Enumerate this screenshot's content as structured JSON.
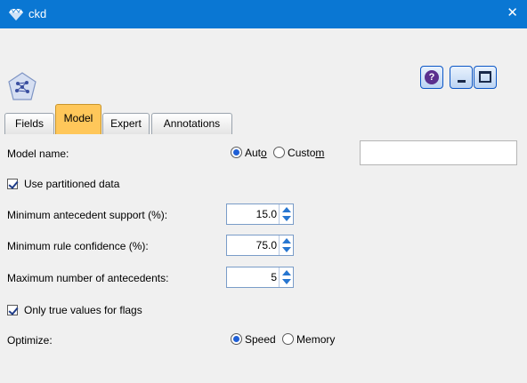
{
  "window": {
    "title": "ckd"
  },
  "tabs": [
    {
      "label": "Fields"
    },
    {
      "label": "Model"
    },
    {
      "label": "Expert"
    },
    {
      "label": "Annotations"
    }
  ],
  "form": {
    "model_name_label": "Model name:",
    "model_name_options": {
      "auto_prefix": "Aut",
      "auto_underlined": "o",
      "custom_prefix": "Custo",
      "custom_underlined": "m",
      "selected": "Auto"
    },
    "model_name_value": "",
    "use_partitioned_label": "Use partitioned data",
    "use_partitioned_checked": true,
    "min_antecedent_support_label": "Minimum antecedent support (%):",
    "min_antecedent_support_value": "15.0",
    "min_rule_confidence_label": "Minimum rule confidence (%):",
    "min_rule_confidence_value": "75.0",
    "max_antecedents_label": "Maximum number of antecedents:",
    "max_antecedents_value": "5",
    "only_true_flags_label": "Only true values for flags",
    "only_true_flags_checked": true,
    "optimize_label": "Optimize:",
    "optimize_options": {
      "speed": "Speed",
      "memory": "Memory",
      "selected": "Speed"
    }
  },
  "colors": {
    "titlebar": "#0a77d3",
    "active_tab": "#ffc75a",
    "panel": "#f0f0f0"
  }
}
